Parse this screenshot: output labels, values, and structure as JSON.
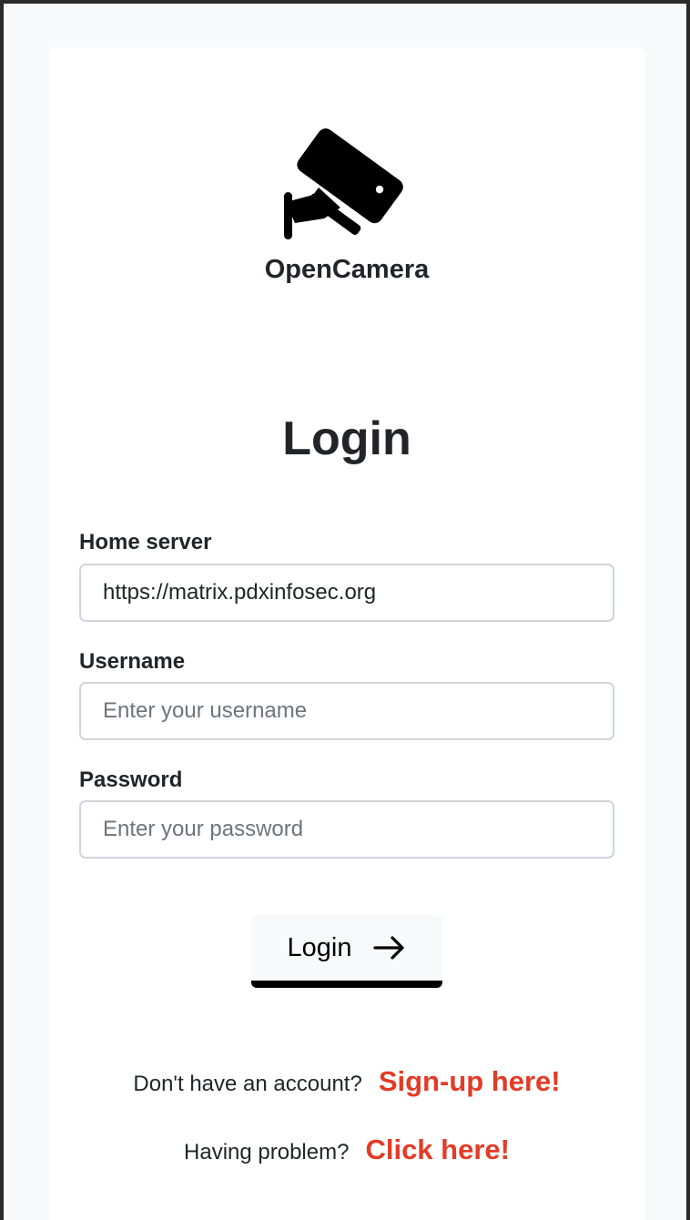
{
  "brand": {
    "name": "OpenCamera",
    "logo_icon": "security-camera-icon"
  },
  "form": {
    "title": "Login",
    "fields": [
      {
        "label": "Home server",
        "value": "https://matrix.pdxinfosec.org",
        "placeholder": ""
      },
      {
        "label": "Username",
        "value": "",
        "placeholder": "Enter your username"
      },
      {
        "label": "Password",
        "value": "",
        "placeholder": "Enter your password"
      }
    ],
    "submit": {
      "label": "Login",
      "icon": "arrow-right-icon"
    }
  },
  "footer": {
    "signup": {
      "text": "Don't have an account?",
      "link": "Sign-up here!"
    },
    "help": {
      "text": "Having problem?",
      "link": "Click here!"
    }
  },
  "colors": {
    "link": "#e33b26",
    "text": "#212529",
    "background": "#f8f9fa",
    "card": "#ffffff"
  }
}
